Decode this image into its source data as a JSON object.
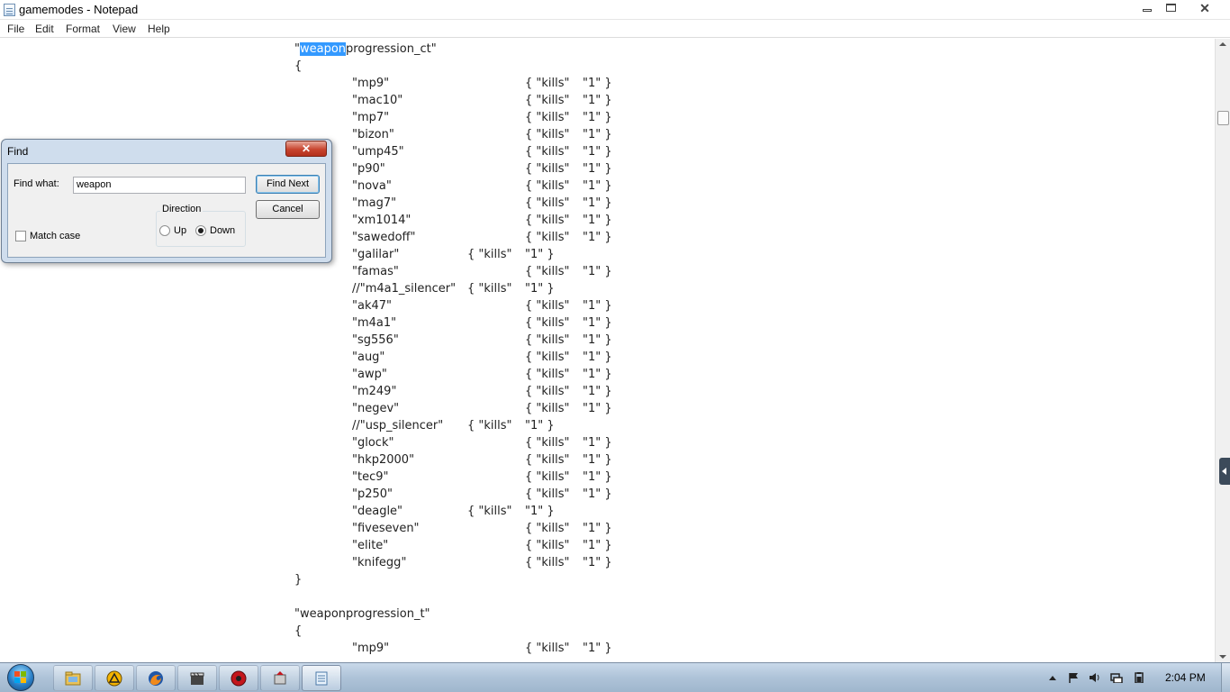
{
  "window": {
    "title": "gamemodes - Notepad"
  },
  "menu": {
    "file": "File",
    "edit": "Edit",
    "format": "Format",
    "view": "View",
    "help": "Help"
  },
  "editor": {
    "section1_prefix": "\"",
    "section1_highlight": "weapon",
    "section1_rest": "progression_ct\"",
    "open_brace": "{",
    "close_brace": "}",
    "section2_header": "\"weaponprogression_t\"",
    "rows": [
      {
        "name": "\"mp9\"",
        "kills": "{ \"kills\"",
        "value": "\"1\" }",
        "short": false
      },
      {
        "name": "\"mac10\"",
        "kills": "{ \"kills\"",
        "value": "\"1\" }",
        "short": false
      },
      {
        "name": "\"mp7\"",
        "kills": "{ \"kills\"",
        "value": "\"1\" }",
        "short": false
      },
      {
        "name": "\"bizon\"",
        "kills": "{ \"kills\"",
        "value": "\"1\" }",
        "short": false
      },
      {
        "name": "\"ump45\"",
        "kills": "{ \"kills\"",
        "value": "\"1\" }",
        "short": false
      },
      {
        "name": "\"p90\"",
        "kills": "{ \"kills\"",
        "value": "\"1\" }",
        "short": false
      },
      {
        "name": "\"nova\"",
        "kills": "{ \"kills\"",
        "value": "\"1\" }",
        "short": false
      },
      {
        "name": "\"mag7\"",
        "kills": "{ \"kills\"",
        "value": "\"1\" }",
        "short": false
      },
      {
        "name": "\"xm1014\"",
        "kills": "{ \"kills\"",
        "value": "\"1\" }",
        "short": false
      },
      {
        "name": "\"sawedoff\"",
        "kills": "{ \"kills\"",
        "value": "\"1\" }",
        "short": false
      },
      {
        "name": "\"galilar\"",
        "kills": "{ \"kills\"",
        "value": "\"1\" }",
        "short": true
      },
      {
        "name": "\"famas\"",
        "kills": "{ \"kills\"",
        "value": "\"1\" }",
        "short": false
      },
      {
        "name": "//\"m4a1_silencer\"",
        "kills": "{ \"kills\"",
        "value": "\"1\" }",
        "short": true
      },
      {
        "name": "\"ak47\"",
        "kills": "{ \"kills\"",
        "value": "\"1\" }",
        "short": false
      },
      {
        "name": "\"m4a1\"",
        "kills": "{ \"kills\"",
        "value": "\"1\" }",
        "short": false
      },
      {
        "name": "\"sg556\"",
        "kills": "{ \"kills\"",
        "value": "\"1\" }",
        "short": false
      },
      {
        "name": "\"aug\"",
        "kills": "{ \"kills\"",
        "value": "\"1\" }",
        "short": false
      },
      {
        "name": "\"awp\"",
        "kills": "{ \"kills\"",
        "value": "\"1\" }",
        "short": false
      },
      {
        "name": "\"m249\"",
        "kills": "{ \"kills\"",
        "value": "\"1\" }",
        "short": false
      },
      {
        "name": "\"negev\"",
        "kills": "{ \"kills\"",
        "value": "\"1\" }",
        "short": false
      },
      {
        "name": "//\"usp_silencer\"",
        "kills": "{ \"kills\"",
        "value": "\"1\" }",
        "short": true
      },
      {
        "name": "\"glock\"",
        "kills": "{ \"kills\"",
        "value": "\"1\" }",
        "short": false
      },
      {
        "name": "\"hkp2000\"",
        "kills": "{ \"kills\"",
        "value": "\"1\" }",
        "short": false
      },
      {
        "name": "\"tec9\"",
        "kills": "{ \"kills\"",
        "value": "\"1\" }",
        "short": false
      },
      {
        "name": "\"p250\"",
        "kills": "{ \"kills\"",
        "value": "\"1\" }",
        "short": false
      },
      {
        "name": "\"deagle\"",
        "kills": "{ \"kills\"",
        "value": "\"1\" }",
        "short": true
      },
      {
        "name": "\"fiveseven\"",
        "kills": "{ \"kills\"",
        "value": "\"1\" }",
        "short": false
      },
      {
        "name": "\"elite\"",
        "kills": "{ \"kills\"",
        "value": "\"1\" }",
        "short": false
      },
      {
        "name": "\"knifegg\"",
        "kills": "{ \"kills\"",
        "value": "\"1\" }",
        "short": false
      }
    ],
    "section2_rows": [
      {
        "name": "\"mp9\"",
        "kills": "{ \"kills\"",
        "value": "\"1\" }",
        "short": false
      }
    ]
  },
  "find_dialog": {
    "title": "Find",
    "close_glyph": "✕",
    "find_what_label": "Find what:",
    "find_what_value": "weapon",
    "find_next": "Find Next",
    "cancel": "Cancel",
    "direction_label": "Direction",
    "up_label": "Up",
    "down_label": "Down",
    "direction_selected": "down",
    "match_case_label": "Match case",
    "match_case_checked": false
  },
  "taskbar": {
    "clock": "2:04 PM",
    "pinned": [
      "windows-explorer-icon",
      "app-triangle-icon",
      "firefox-icon",
      "media-clapper-icon",
      "red-ball-icon",
      "game-app-icon",
      "notepad-icon"
    ]
  },
  "colors": {
    "selection": "#3399ff",
    "close_button": "#c8452f",
    "dialog_frame": "#cfdded"
  }
}
